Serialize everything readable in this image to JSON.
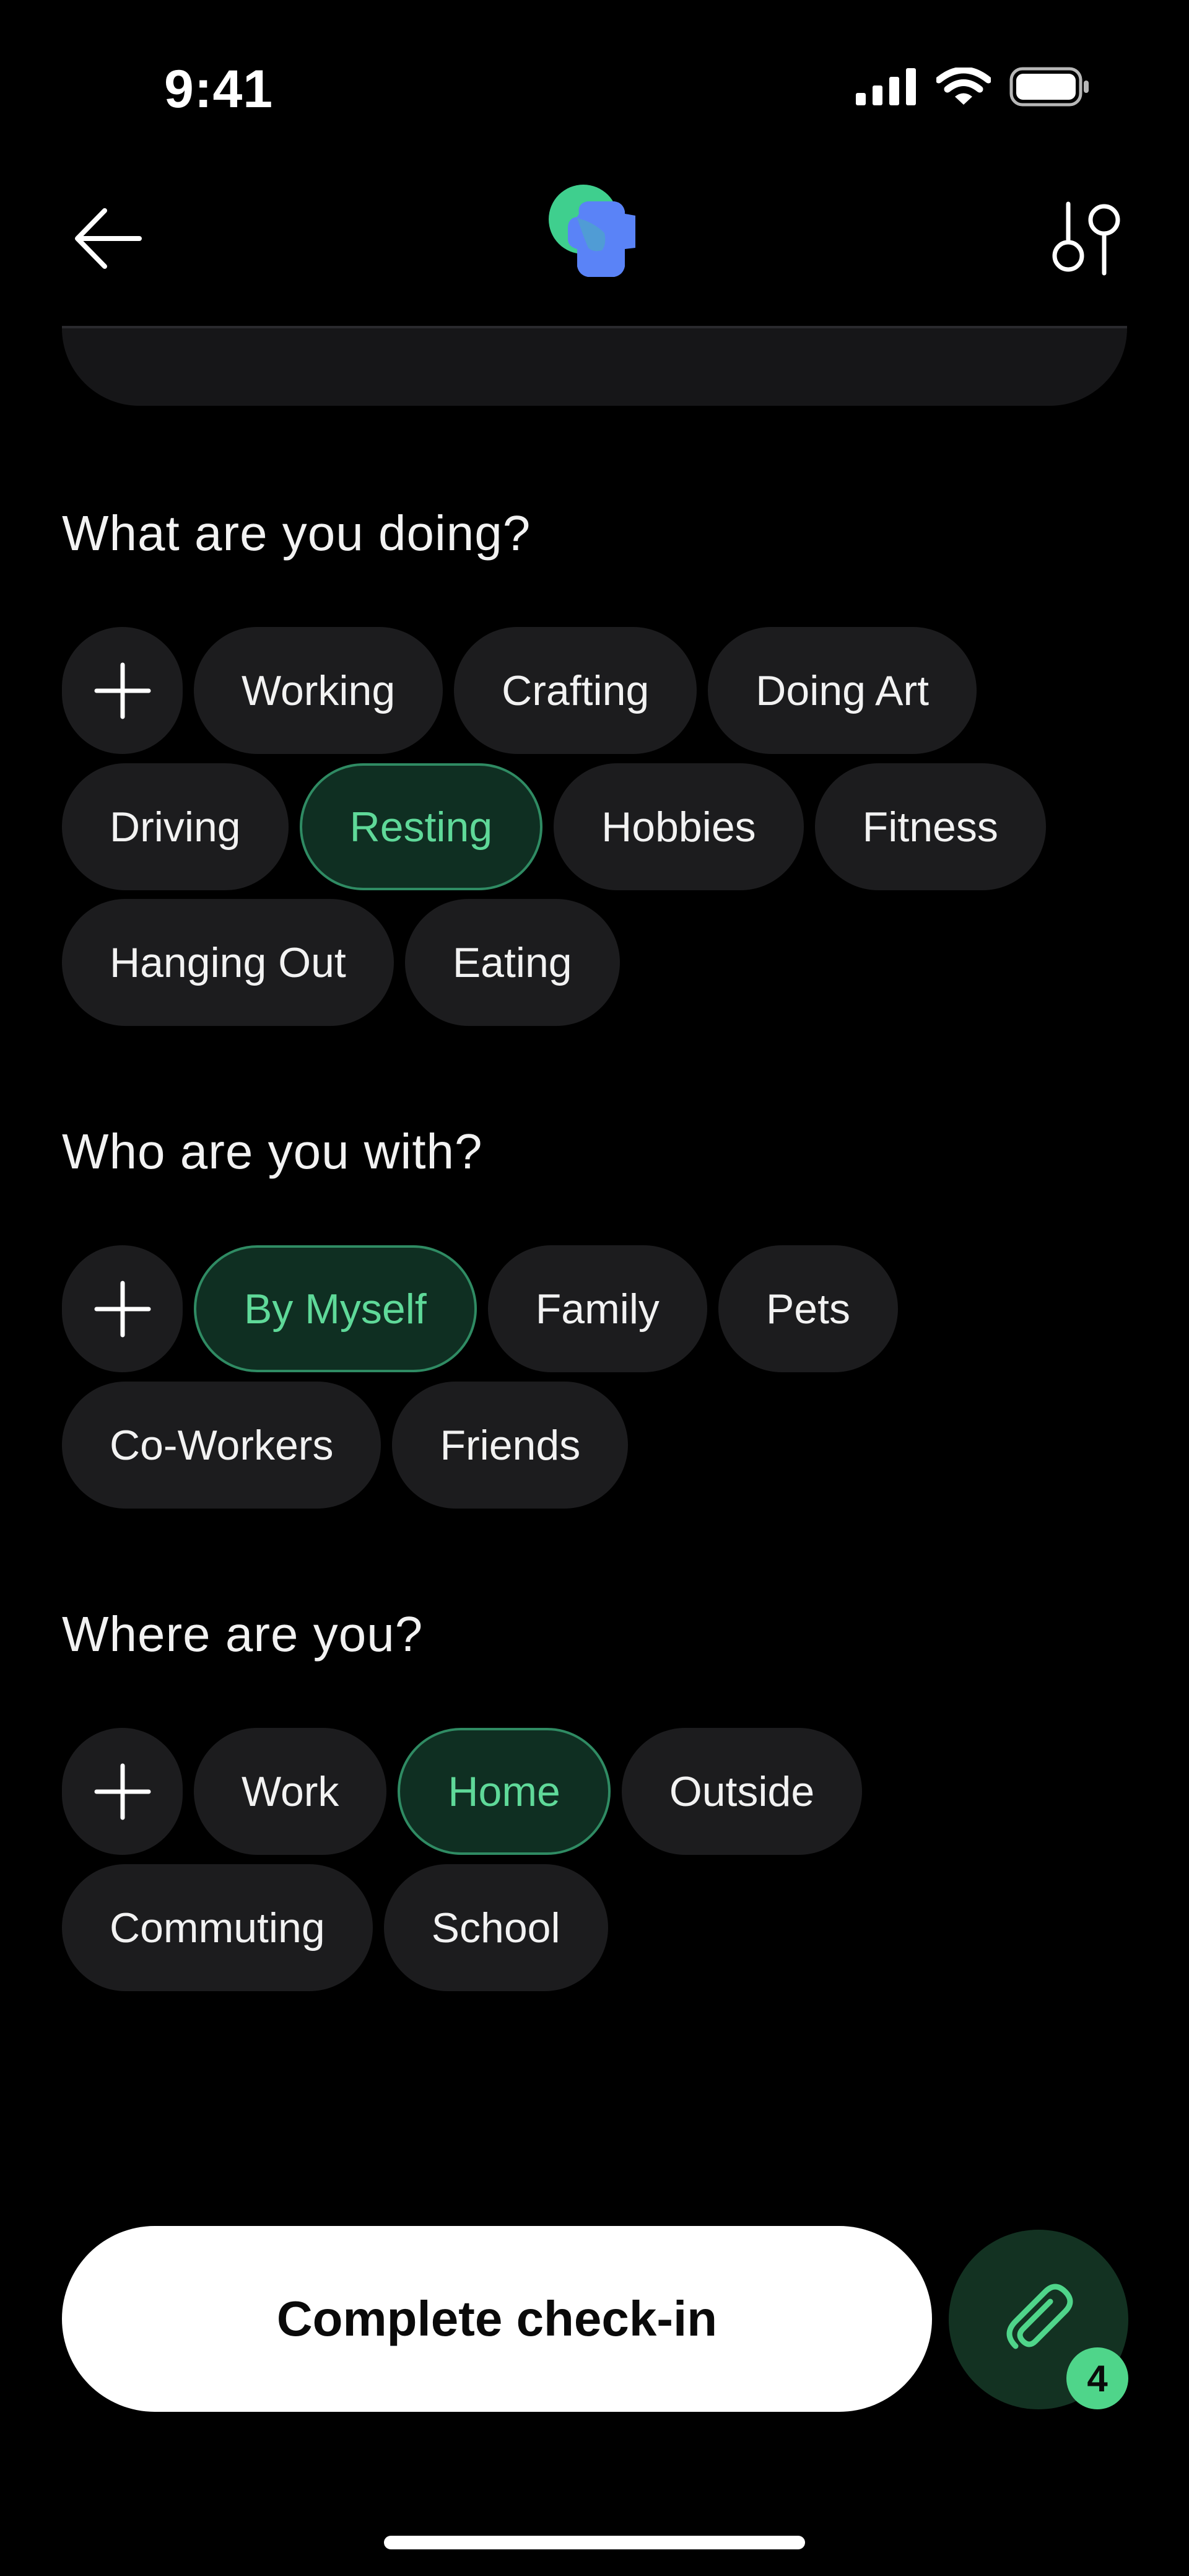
{
  "status_bar": {
    "time": "9:41",
    "icons": [
      "cellular-signal-icon",
      "wifi-icon",
      "battery-icon"
    ]
  },
  "nav": {
    "back_icon": "arrow-left-icon",
    "logo": "app-logo",
    "filter_icon": "sliders-icon"
  },
  "colors": {
    "background": "#000000",
    "chip": "#1c1c1e",
    "selected_bg": "#0f2f22",
    "selected_border": "#2f8b63",
    "selected_text": "#5fd999",
    "accent": "#4fd58a"
  },
  "sections": {
    "doing": {
      "title": "What are you doing?",
      "chips": [
        "Working",
        "Crafting",
        "Doing Art",
        "Driving",
        "Resting",
        "Hobbies",
        "Fitness",
        "Hanging Out",
        "Eating"
      ],
      "selected": "Resting"
    },
    "with": {
      "title": "Who are you with?",
      "chips": [
        "By Myself",
        "Family",
        "Pets",
        "Co-Workers",
        "Friends"
      ],
      "selected": "By Myself"
    },
    "where": {
      "title": "Where are you?",
      "chips": [
        "Work",
        "Home",
        "Outside",
        "Commuting",
        "School"
      ],
      "selected": "Home"
    }
  },
  "footer": {
    "complete_label": "Complete check-in",
    "attach_icon": "paperclip-icon",
    "attach_count": "4"
  }
}
